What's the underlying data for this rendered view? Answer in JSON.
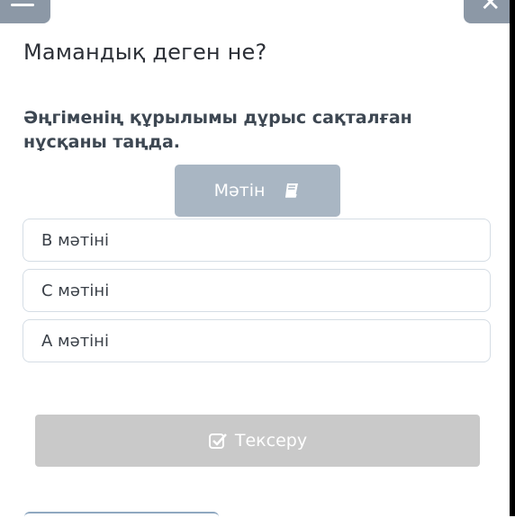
{
  "header": {
    "menu_icon": "hamburger-icon",
    "close_icon": "close-icon"
  },
  "page": {
    "title": "Мамандық деген не?"
  },
  "question": {
    "text": "Әңгіменің құрылымы дұрыс сақталған нұсқаны таңда."
  },
  "text_button": {
    "label": "Мәтін",
    "icon": "book-icon"
  },
  "options": [
    {
      "label": "В мәтіні"
    },
    {
      "label": "С мәтіні"
    },
    {
      "label": "А мәтіні"
    }
  ],
  "check_button": {
    "label": "Тексеру",
    "icon": "checkbox-icon",
    "state": "disabled"
  },
  "colors": {
    "accent_gray": "#a9b6c3",
    "disabled": "#c9c9c9",
    "border": "#d5dde5"
  }
}
